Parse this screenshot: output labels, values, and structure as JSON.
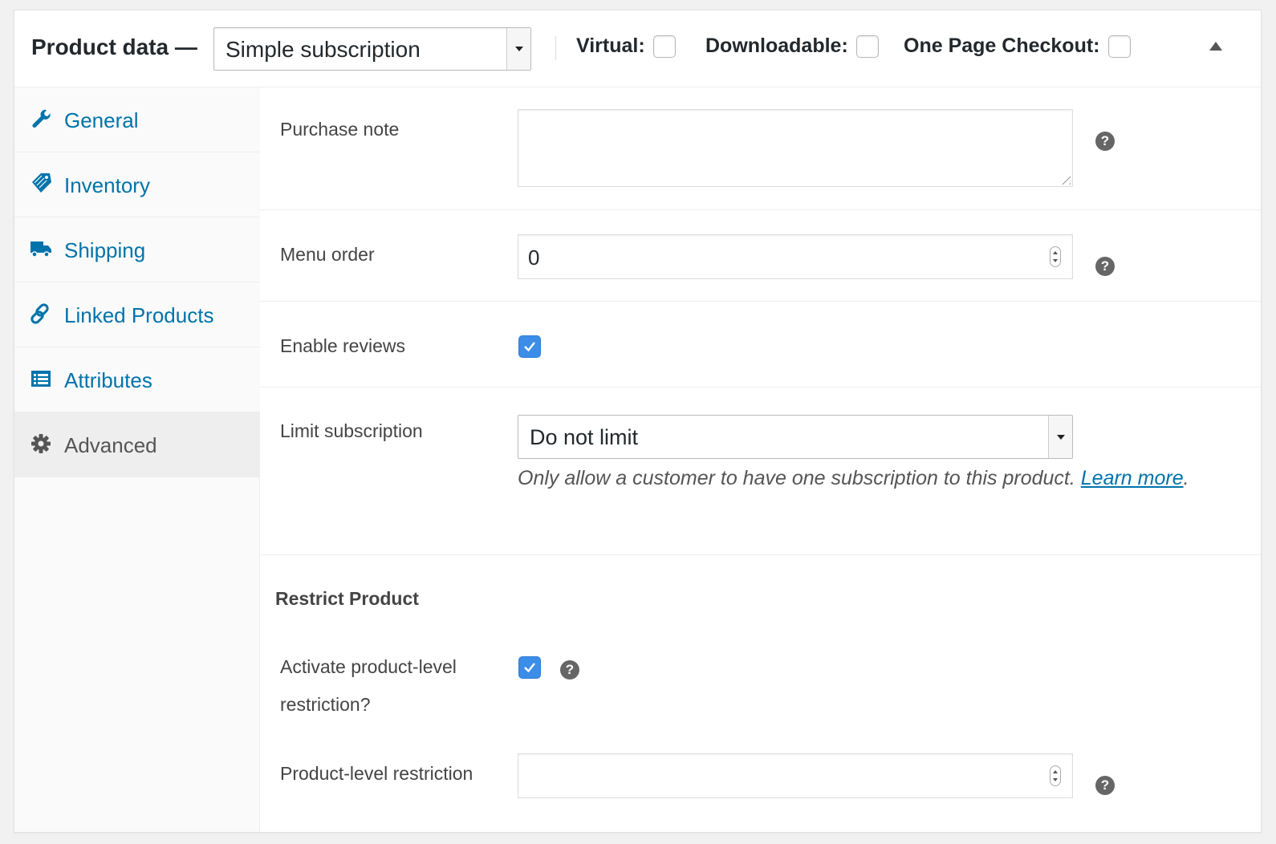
{
  "header": {
    "title": "Product data —",
    "product_type": "Simple subscription",
    "checkboxes": {
      "virtual": "Virtual:",
      "downloadable": "Downloadable:",
      "one_page_checkout": "One Page Checkout:"
    }
  },
  "sidebar": {
    "items": [
      {
        "label": "General",
        "icon": "wrench-icon"
      },
      {
        "label": "Inventory",
        "icon": "tag-icon"
      },
      {
        "label": "Shipping",
        "icon": "truck-icon"
      },
      {
        "label": "Linked Products",
        "icon": "link-icon"
      },
      {
        "label": "Attributes",
        "icon": "list-icon"
      },
      {
        "label": "Advanced",
        "icon": "gear-icon",
        "active": true
      }
    ]
  },
  "fields": {
    "purchase_note": {
      "label": "Purchase note",
      "value": ""
    },
    "menu_order": {
      "label": "Menu order",
      "value": "0"
    },
    "enable_reviews": {
      "label": "Enable reviews",
      "checked": true
    },
    "limit_subscription": {
      "label": "Limit subscription",
      "value": "Do not limit",
      "description": "Only allow a customer to have one subscription to this product.",
      "link_text": "Learn more",
      "link_suffix": "."
    },
    "restrict_product": {
      "title": "Restrict Product"
    },
    "activate_restriction": {
      "label": "Activate product-level restriction?",
      "checked": true
    },
    "product_level_restriction": {
      "label": "Product-level restriction",
      "value": ""
    }
  },
  "help_glyph": "?",
  "colors": {
    "link": "#0073aa",
    "checkbox": "#3b8de8"
  }
}
